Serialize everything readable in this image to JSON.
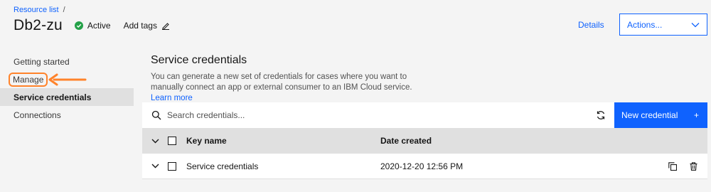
{
  "breadcrumb": {
    "link": "Resource list",
    "separator": "/"
  },
  "header": {
    "title": "Db2-zu",
    "status": "Active",
    "add_tags": "Add tags",
    "details_link": "Details",
    "actions_label": "Actions..."
  },
  "sidebar": {
    "items": [
      {
        "label": "Getting started"
      },
      {
        "label": "Manage"
      },
      {
        "label": "Service credentials"
      },
      {
        "label": "Connections"
      }
    ]
  },
  "main": {
    "title": "Service credentials",
    "description": "You can generate a new set of credentials for cases where you want to manually connect an app or external consumer to an IBM Cloud service.",
    "learn_more": "Learn more",
    "search_placeholder": "Search credentials...",
    "new_button": "New credential",
    "new_button_icon": "+",
    "table": {
      "headers": {
        "name": "Key name",
        "date": "Date created"
      },
      "rows": [
        {
          "name": "Service credentials",
          "date": "2020-12-20 12:56 PM"
        }
      ]
    }
  },
  "colors": {
    "accent": "#0f62fe",
    "status_green": "#24a148",
    "annotation": "#ff832b"
  },
  "icons": [
    "check-circle-icon",
    "pencil-icon",
    "chevron-down-icon",
    "search-icon",
    "refresh-icon",
    "copy-icon",
    "trash-icon",
    "arrow-left-icon"
  ]
}
